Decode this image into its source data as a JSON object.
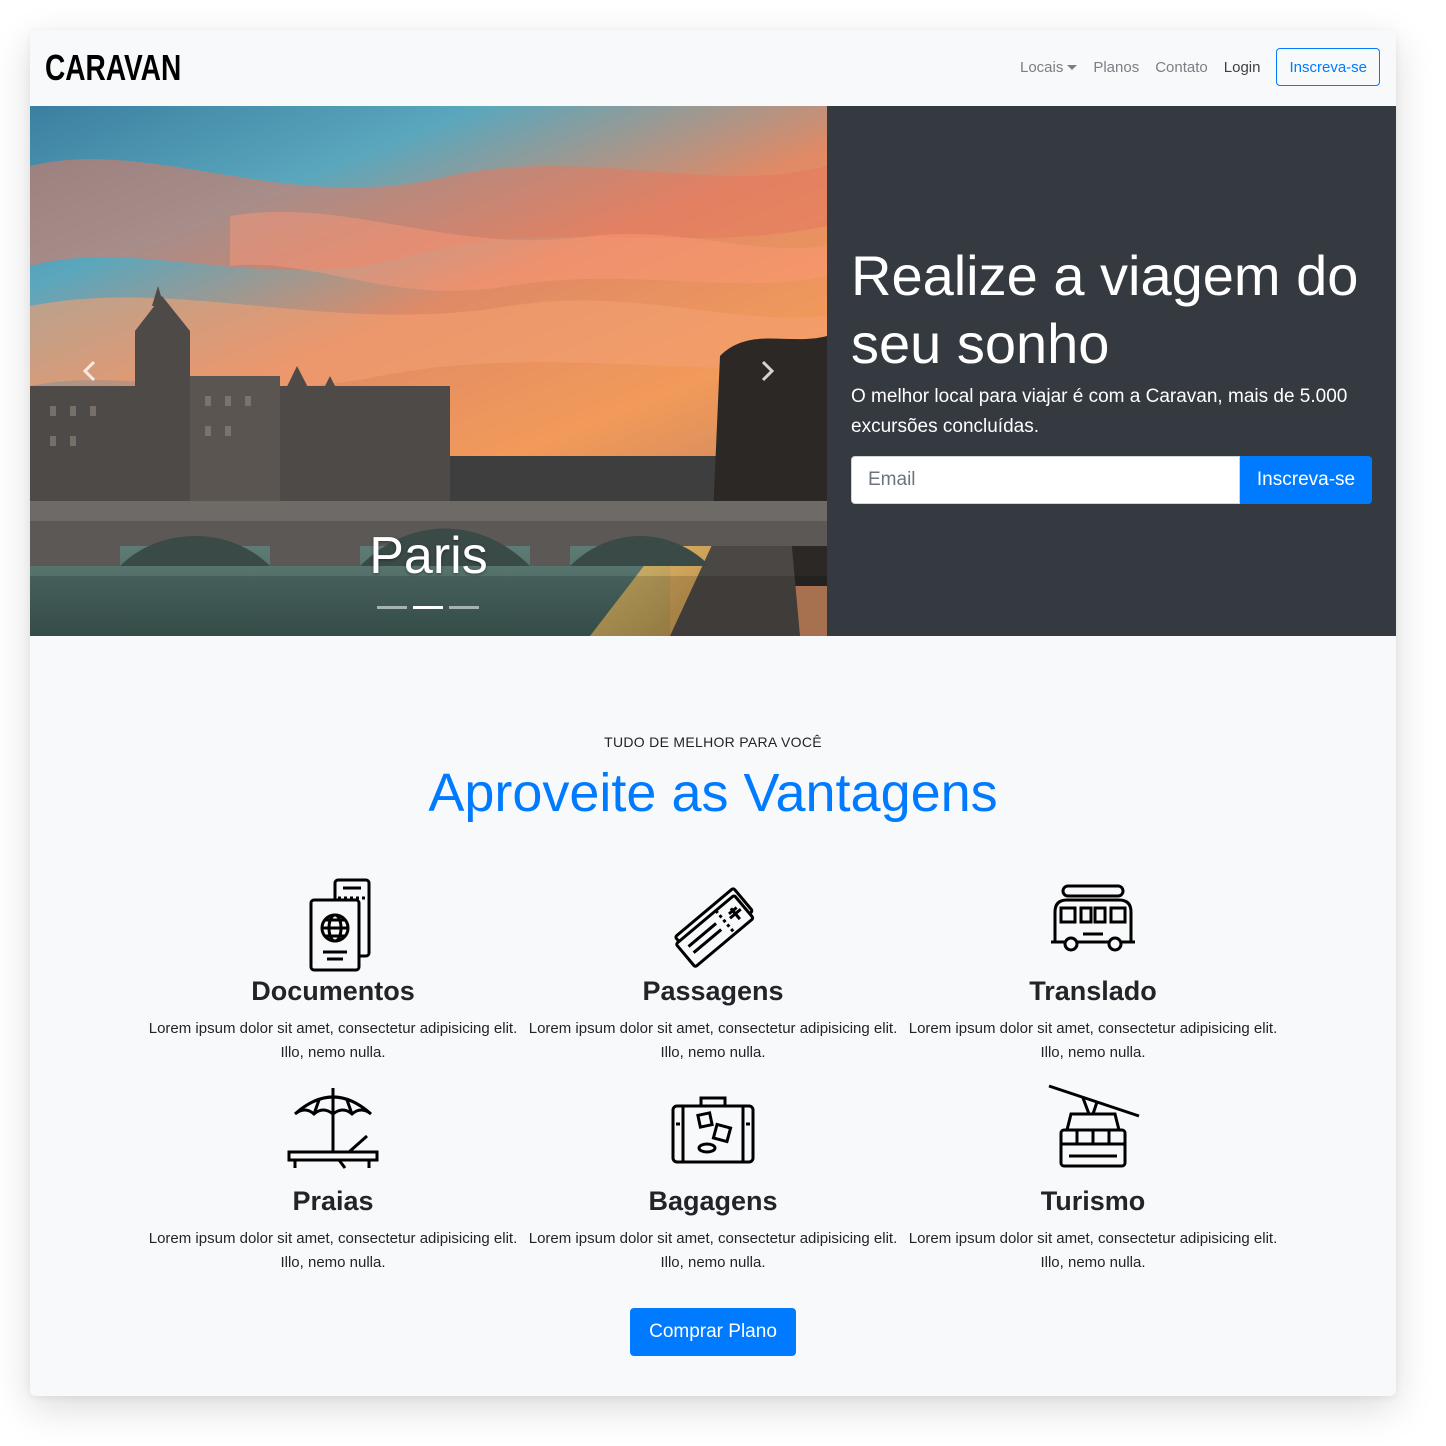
{
  "navbar": {
    "brand": "CARAVAN",
    "links": [
      "Locais",
      "Planos",
      "Contato",
      "Login"
    ],
    "signup_label": "Inscreva-se"
  },
  "hero": {
    "slide_caption": "Paris",
    "slide_count": 3,
    "active_slide": 2,
    "headline": "Realize a viagem do seu sonho",
    "lead": "O melhor local para viajar é com a Caravan, mais de 5.000 excursões concluídas.",
    "email_placeholder": "Email",
    "subscribe_label": "Inscreva-se"
  },
  "features": {
    "eyebrow": "TUDO DE MELHOR PARA VOCÊ",
    "title": "Aproveite as Vantagens",
    "items": [
      {
        "icon": "passport-icon",
        "title": "Documentos",
        "text": "Lorem ipsum dolor sit amet, consectetur adipisicing elit. Illo, nemo nulla."
      },
      {
        "icon": "plane-ticket-icon",
        "title": "Passagens",
        "text": "Lorem ipsum dolor sit amet, consectetur adipisicing elit. Illo, nemo nulla."
      },
      {
        "icon": "van-icon",
        "title": "Translado",
        "text": "Lorem ipsum dolor sit amet, consectetur adipisicing elit. Illo, nemo nulla."
      },
      {
        "icon": "beach-umbrella-icon",
        "title": "Praias",
        "text": "Lorem ipsum dolor sit amet, consectetur adipisicing elit. Illo, nemo nulla."
      },
      {
        "icon": "suitcase-icon",
        "title": "Bagagens",
        "text": "Lorem ipsum dolor sit amet, consectetur adipisicing elit. Illo, nemo nulla."
      },
      {
        "icon": "cable-car-icon",
        "title": "Turismo",
        "text": "Lorem ipsum dolor sit amet, consectetur adipisicing elit. Illo, nemo nulla."
      }
    ],
    "cta_label": "Comprar Plano"
  },
  "colors": {
    "primary": "#007bff",
    "hero_panel": "#343a40",
    "page_background": "#f8f9fa"
  }
}
